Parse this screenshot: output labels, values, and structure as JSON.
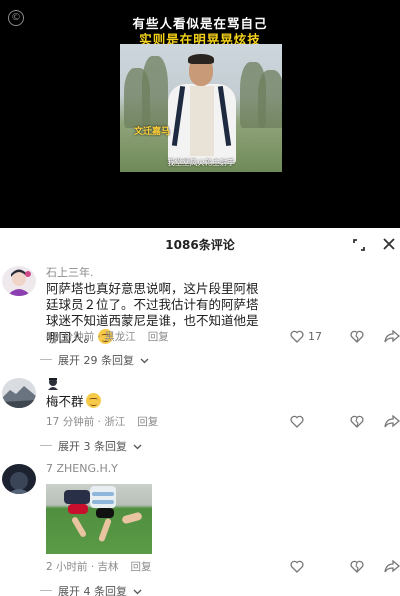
{
  "video": {
    "caption_line1": "有些人看似是在骂自己",
    "caption_line2": "实则是在明晃晃炫技",
    "copyright_symbol": "©",
    "overlay_tag": "文迁嘉马",
    "subtitle": "我堂堂风火轮主射手"
  },
  "comments_panel": {
    "count_label": "1086条评论",
    "shrink_icon": "shrink-icon",
    "close_icon": "close-icon"
  },
  "comments": [
    {
      "username": "石上三年.",
      "text": "阿萨塔也真好意思说啊，这片段里阿根廷球员２位了。不过我估计有的阿萨塔球迷不知道西蒙尼是谁，也不知道他是哪国人。",
      "time": "49 分钟前 · 黑龙江",
      "reply": "回复",
      "likes": "17",
      "expand": "展开 29 条回复"
    },
    {
      "username": "",
      "text": "梅不群",
      "time": "17 分钟前 · 浙江",
      "reply": "回复",
      "likes": "",
      "expand": "展开 3 条回复"
    },
    {
      "username": "7 ZHENG.H.Y",
      "text": "",
      "time": "2 小时前 · 吉林",
      "reply": "回复",
      "likes": "",
      "expand": "展开 4 条回复"
    }
  ],
  "colors": {
    "caption_yellow": "#f4d21a",
    "meta_gray": "#8a8a8a"
  }
}
